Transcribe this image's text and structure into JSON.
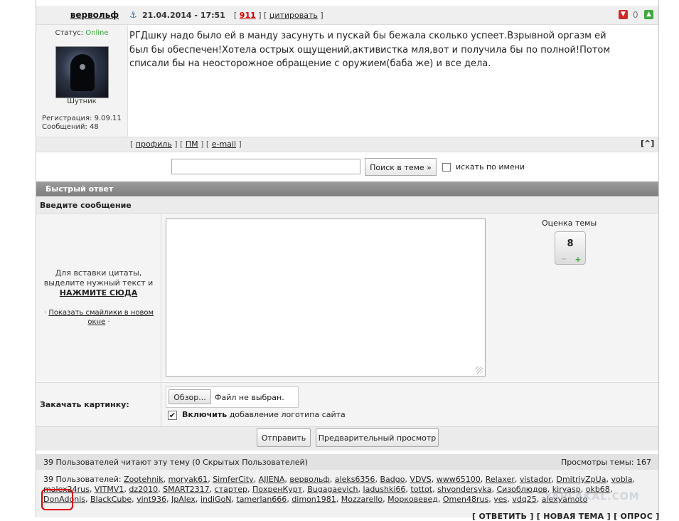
{
  "post": {
    "author": "вервольф",
    "date": "21.04.2014 - 17:51",
    "link_open": "[",
    "number": "911",
    "link_mid": "] [",
    "quote_label": "цитировать",
    "link_close": "]",
    "rating_value": "0",
    "status_label": "Статус:",
    "status_value": "Online",
    "rank": "Шутник",
    "reg_line": "Регистрация: 9.09.11",
    "msgs_line": "Сообщений: 48",
    "text": "РГДшку надо было ей в манду засунуть и пускай бы бежала сколько успеет.Взрывной оргазм ей был бы обеспечен!Хотела острых ощущений,активистка мля,вот и получила бы по полной!Потом списали бы на неосторожное обращение с оружием(баба же) и все дела.",
    "footer": {
      "b1": "[",
      "profile": "профиль",
      "b2": "] [",
      "pm": "ПМ",
      "b3": "] [",
      "email": "e-mail",
      "b4": "]",
      "top": "[^]"
    }
  },
  "search": {
    "button": "Поиск в теме »",
    "by_name": "искать по имени"
  },
  "quick_reply": {
    "title": "Быстрый ответ",
    "message_title": "Введите сообщение",
    "quote_tip_1": "Для вставки цитаты,",
    "quote_tip_2": "выделите нужный текст и",
    "quote_tip_3": "НАЖМИТЕ СЮДА",
    "smiles_bullet_left": "·",
    "smiles_link": "Показать смайлики в новом окне",
    "smiles_bullet_right": "·",
    "rating_label": "Оценка темы",
    "rating_value": "8",
    "rating_minus": "−",
    "rating_plus": "+",
    "upload_label": "Закачать картинку:",
    "browse": "Обзор...",
    "no_file": "Файл не выбран.",
    "logo_check": "✔",
    "logo_bold": "Включить",
    "logo_rest": " добавление логотипа сайта",
    "send": "Отправить",
    "preview": "Предварительный просмотр"
  },
  "readers": {
    "count_text": "39 Пользователей читают эту тему (0 Скрытых Пользователей)",
    "views_text": "Просмотры темы: 167",
    "prefix": "39 Пользователей:",
    "users": [
      "Zootehnik",
      "moryak61",
      "SimferCity",
      "AJIENA",
      "вервольф",
      "aleks6356",
      "Badgo",
      "VDVS",
      "www65100",
      "Relaxer",
      "vistador",
      "DmitriyZpUa",
      "vobla",
      "malex24rus",
      "VITMV1",
      "dz2010",
      "SMART2317",
      "стартер",
      "ПохренКурт",
      "Bugagaevich",
      "ladushki66",
      "tottot",
      "shvondersyka",
      "Сизоблюдов",
      "kiryasp",
      "okb68",
      "DonAdonis",
      "BlackCube",
      "vint936",
      "JpAlex",
      "indiGoN",
      "tamerlan666",
      "dimon1981",
      "Mozzarello",
      "Морковевед",
      "Omen48rus",
      "yes",
      "vdq25",
      "alexyamoto"
    ]
  },
  "bottom_links": "[ ОТВЕТИТЬ ] [ НОВАЯ ТЕМА ] [ ОПРОС ]",
  "watermark": "YAPLAKAL.COM",
  "colors": {
    "online": "#3aa53a",
    "post_number": "#d00000",
    "highlight": "#e00000",
    "quick_reply_bar": "#8c8c8c"
  }
}
